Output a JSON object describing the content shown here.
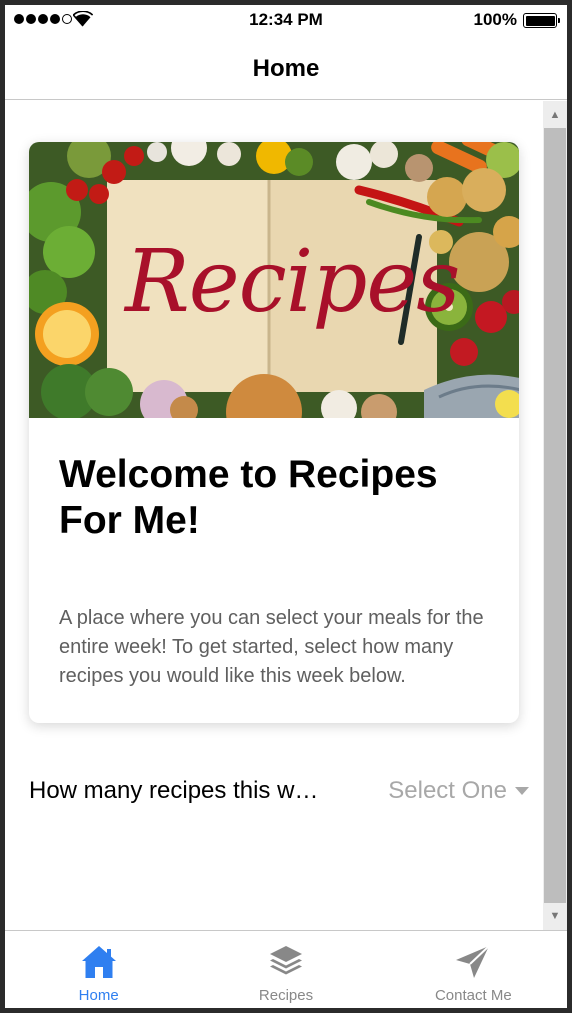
{
  "status_bar": {
    "time": "12:34 PM",
    "battery_percent": "100%",
    "signal_bars_filled": 4,
    "signal_bars_total": 5
  },
  "nav": {
    "title": "Home"
  },
  "hero": {
    "image_text": "Recipes"
  },
  "card": {
    "title": "Welcome to Recipes For Me!",
    "description": "A place where you can select your meals for the entire week! To get started, select how many recipes you would like this week below."
  },
  "recipe_select": {
    "label": "How many recipes this w…",
    "value": "Select One"
  },
  "tabs": [
    {
      "label": "Home",
      "icon": "home-icon",
      "active": true
    },
    {
      "label": "Recipes",
      "icon": "layers-icon",
      "active": false
    },
    {
      "label": "Contact Me",
      "icon": "paper-plane-icon",
      "active": false
    }
  ],
  "colors": {
    "accent": "#2f7ff0",
    "inactive_tab": "#888888",
    "recipe_word": "#a8102a",
    "placeholder": "#a8a8a8"
  }
}
